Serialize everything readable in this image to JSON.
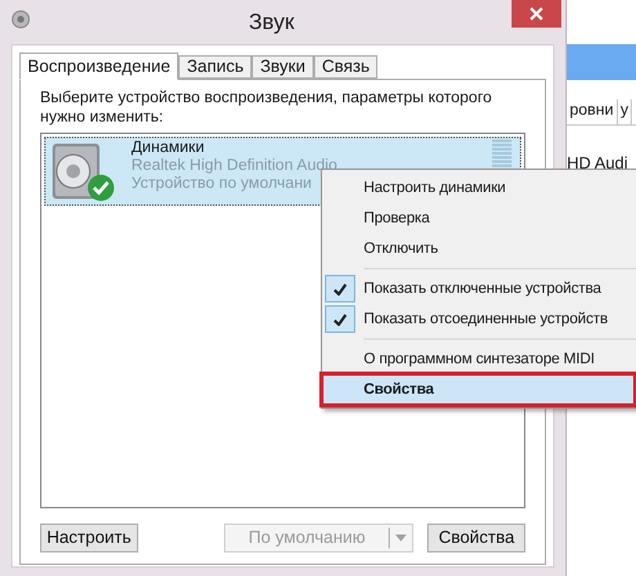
{
  "window": {
    "title": "Звук"
  },
  "tabs": [
    {
      "label": "Воспроизведение",
      "selected": true
    },
    {
      "label": "Запись",
      "selected": false
    },
    {
      "label": "Звуки",
      "selected": false
    },
    {
      "label": "Связь",
      "selected": false
    }
  ],
  "instruction": "Выберите устройство воспроизведения, параметры которого нужно изменить:",
  "devices": [
    {
      "name": "Динамики",
      "driver": "Realtek High Definition Audio",
      "status": "Устройство по умолчани",
      "selected": true,
      "default": true
    }
  ],
  "buttons": [
    {
      "label": "Настроить",
      "disabled": false,
      "kind": "plain"
    },
    {
      "label": "По умолчанию",
      "disabled": true,
      "kind": "split"
    },
    {
      "label": "Свойства",
      "disabled": false,
      "kind": "plain"
    }
  ],
  "background_window": {
    "tabs": [
      "ровни",
      "у"
    ],
    "text": "HD Audi"
  },
  "context_menu": [
    {
      "kind": "item",
      "label": "Настроить динамики",
      "checked": false,
      "selected": false,
      "outlined": false
    },
    {
      "kind": "item",
      "label": "Проверка",
      "checked": false,
      "selected": false,
      "outlined": false
    },
    {
      "kind": "item",
      "label": "Отключить",
      "checked": false,
      "selected": false,
      "outlined": false
    },
    {
      "kind": "separator"
    },
    {
      "kind": "item",
      "label": "Показать отключенные устройства",
      "checked": true,
      "selected": false,
      "outlined": false
    },
    {
      "kind": "item",
      "label": "Показать отсоединенные устройств",
      "checked": true,
      "selected": false,
      "outlined": false
    },
    {
      "kind": "separator"
    },
    {
      "kind": "item",
      "label": "О программном синтезаторе MIDI",
      "checked": false,
      "selected": false,
      "outlined": false
    },
    {
      "kind": "item",
      "label": "Свойства",
      "checked": false,
      "selected": true,
      "outlined": true
    }
  ]
}
